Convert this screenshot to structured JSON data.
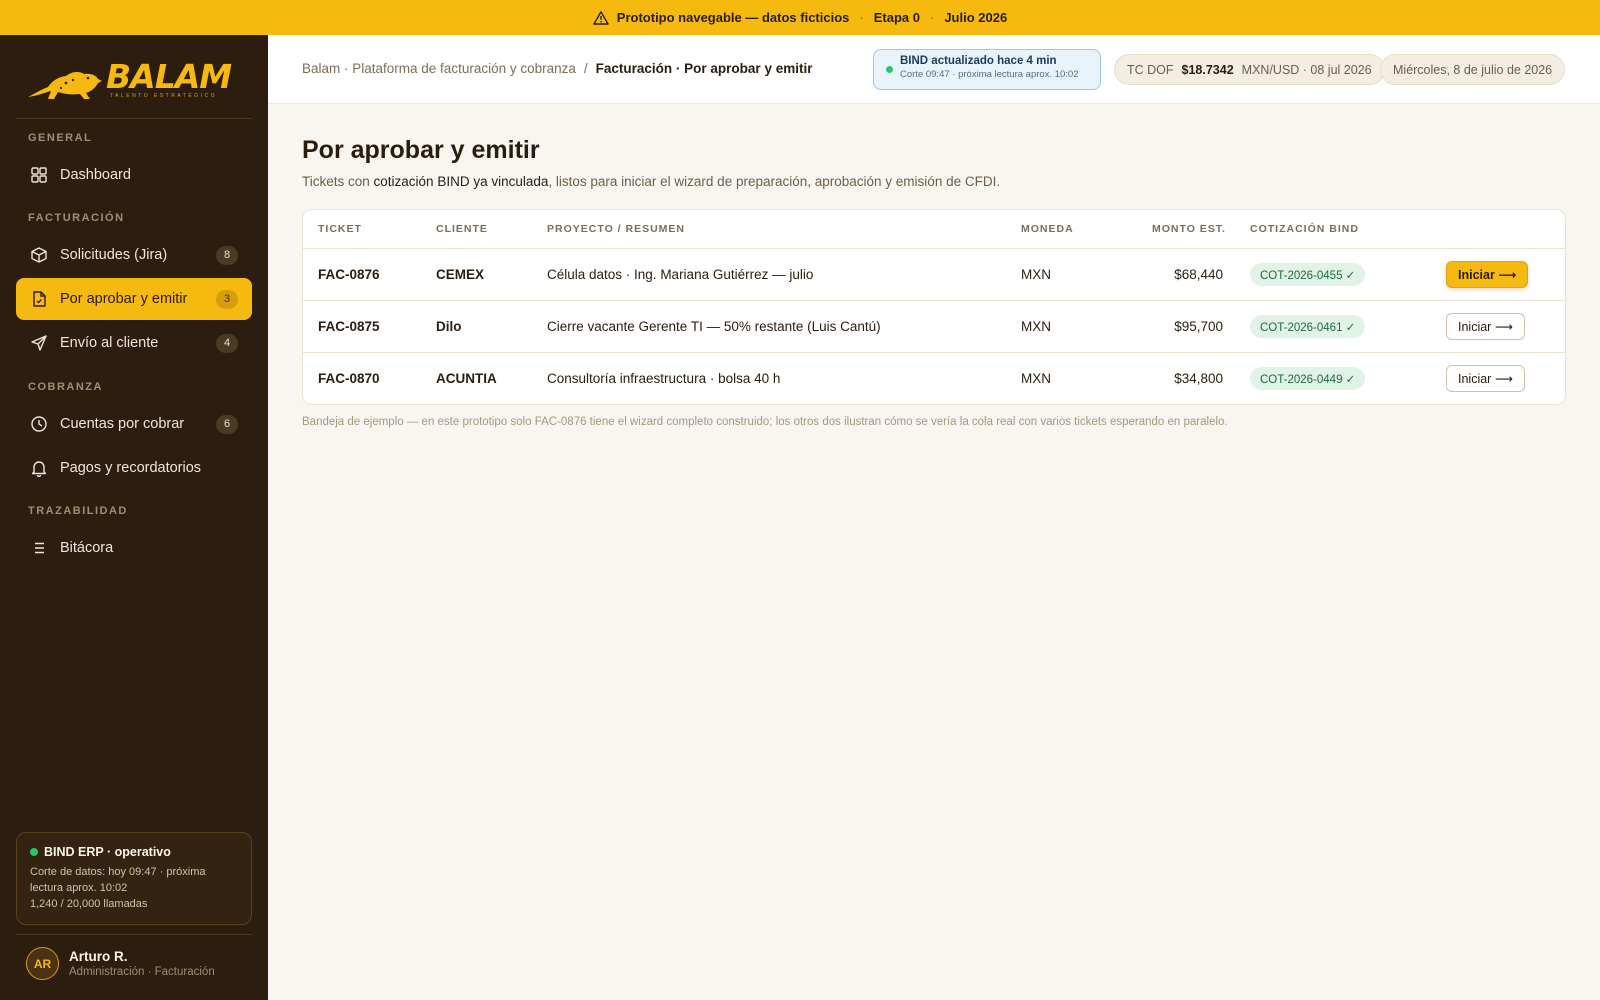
{
  "banner": {
    "text": "Prototipo navegable — datos ficticios",
    "stage": "Etapa 0",
    "date": "Julio 2026"
  },
  "sidebar": {
    "logo_text": "BALAM",
    "logo_tagline": "TALENTO ESTRATÉGICO",
    "sections": {
      "general": "GENERAL",
      "facturacion": "FACTURACIÓN",
      "cobranza": "COBRANZA",
      "trazabilidad": "TRAZABILIDAD"
    },
    "items": [
      {
        "label": "Dashboard",
        "icon": "grid-icon"
      },
      {
        "label": "Solicitudes (Jira)",
        "count": "8",
        "icon": "box-icon"
      },
      {
        "label": "Por aprobar y emitir",
        "count": "3",
        "icon": "document-icon",
        "active": true
      },
      {
        "label": "Envío al cliente",
        "count": "4",
        "icon": "send-icon"
      },
      {
        "label": "Cuentas por cobrar",
        "count": "6",
        "icon": "clock-icon"
      },
      {
        "label": "Pagos y recordatorios",
        "icon": "bell-icon"
      },
      {
        "label": "Bitácora",
        "icon": "list-icon"
      }
    ],
    "status": {
      "title": "BIND ERP · operativo",
      "desc": "Corte de datos: hoy 09:47 · próxima lectura aprox. 10:02",
      "calls": "1,240 / 20,000 llamadas"
    },
    "user": {
      "initials": "AR",
      "name": "Arturo R.",
      "role": "Administración · Facturación"
    }
  },
  "header": {
    "breadcrumb_root": "Balam · Plataforma de facturación y cobranza",
    "breadcrumb_sep": "/",
    "breadcrumb_current": "Facturación · Por aprobar y emitir",
    "bind_status": "BIND actualizado hace 4 min",
    "bind_detail": "Corte 09:47 · próxima lectura aprox. 10:02",
    "tc_label": "TC DOF",
    "tc_value": "$18.7342",
    "tc_detail": "MXN/USD · 08 jul 2026",
    "date": "Miércoles, 8 de julio de 2026"
  },
  "main": {
    "title": "Por aprobar y emitir",
    "subtitle_pre": "Tickets con ",
    "subtitle_bold": "cotización BIND ya vinculada",
    "subtitle_post": ", listos para iniciar el wizard de preparación, aprobación y emisión de CFDI.",
    "columns": [
      "TICKET",
      "CLIENTE",
      "PROYECTO / RESUMEN",
      "MONEDA",
      "MONTO EST.",
      "COTIZACIÓN BIND"
    ],
    "rows": [
      {
        "ticket": "FAC-0876",
        "client": "CEMEX",
        "summary": "Célula datos · Ing. Mariana Gutiérrez — julio",
        "currency": "MXN",
        "amount": "$68,440",
        "quote": "COT-2026-0455 ✓",
        "action": "Iniciar ⟶",
        "primary": true
      },
      {
        "ticket": "FAC-0875",
        "client": "Dilo",
        "summary": "Cierre vacante Gerente TI — 50% restante (Luis Cantú)",
        "currency": "MXN",
        "amount": "$95,700",
        "quote": "COT-2026-0461 ✓",
        "action": "Iniciar ⟶",
        "primary": false
      },
      {
        "ticket": "FAC-0870",
        "client": "ACUNTIA",
        "summary": "Consultoría infraestructura · bolsa 40 h",
        "currency": "MXN",
        "amount": "$34,800",
        "quote": "COT-2026-0449 ✓",
        "action": "Iniciar ⟶",
        "primary": false
      }
    ],
    "footnote": "Bandeja de ejemplo — en este prototipo solo FAC-0876 tiene el wizard completo construido; los otros dos ilustran cómo se vería la cola real con varios tickets esperando en paralelo."
  },
  "colors": {
    "accent": "#f6b90f",
    "sidebar_bg": "#2c1d0f",
    "status_ok": "#28c76f"
  }
}
